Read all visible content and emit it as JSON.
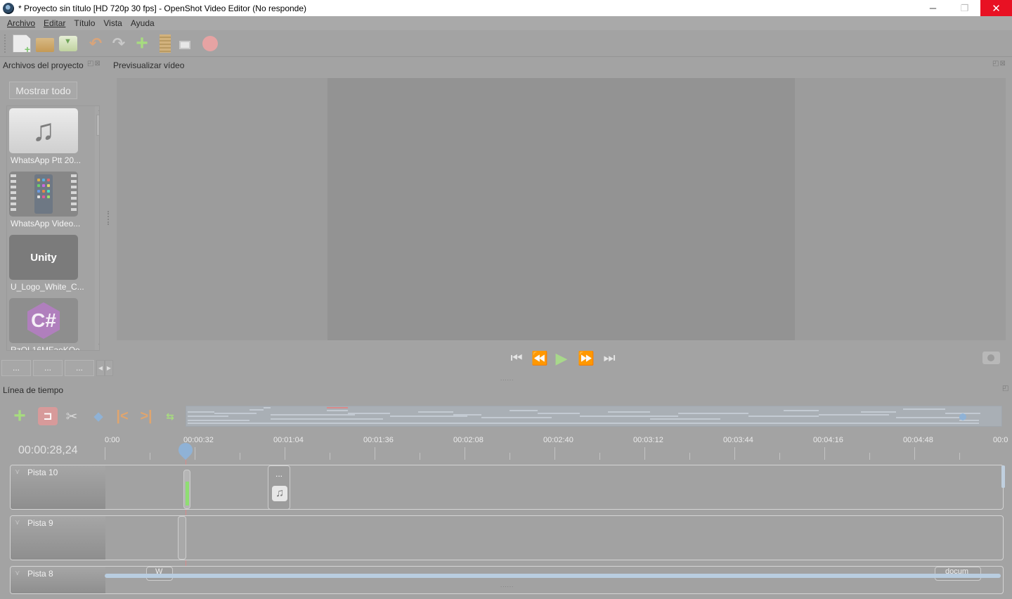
{
  "window": {
    "title": "* Proyecto sin título [HD 720p 30 fps] - OpenShot Video Editor (No responde)",
    "minimize": "─",
    "restore": "❐",
    "close": "✕"
  },
  "menu": [
    "Archivo",
    "Editar",
    "Título",
    "Vista",
    "Ayuda"
  ],
  "toolbar": {
    "icons": [
      "new-project-icon",
      "open-project-icon",
      "save-project-icon",
      "undo-icon",
      "redo-icon",
      "import-files-icon",
      "choose-profile-icon",
      "fullscreen-icon",
      "export-video-icon"
    ]
  },
  "project_files": {
    "header": "Archivos del proyecto",
    "dock_controls": "◰⊠",
    "show_all": "Mostrar todo",
    "files": [
      {
        "name": "WhatsApp Ptt 20...",
        "kind": "audio"
      },
      {
        "name": "WhatsApp Video...",
        "kind": "video"
      },
      {
        "name": "U_Logo_White_C...",
        "kind": "image",
        "thumb_text": "Unity"
      },
      {
        "name": "RzQL16MFaeKQe...",
        "kind": "image",
        "thumb_text": "C#"
      }
    ],
    "bottom_buttons": [
      "...",
      "...",
      "..."
    ],
    "scroll_left": "◀",
    "scroll_right": "▶"
  },
  "preview": {
    "header": "Previsualizar vídeo",
    "dock_controls": "◰⊠",
    "controls": {
      "jump_start": "⏮",
      "rewind": "⏪",
      "play": "▶",
      "fast_forward": "⏩",
      "jump_end": "⏭"
    },
    "splitter": "......"
  },
  "timeline": {
    "header": "Línea de tiempo",
    "dock_controls": "◰",
    "current_time": "00:00:28,24",
    "ruler_labels": [
      "0:00",
      "00:00:32",
      "00:01:04",
      "00:01:36",
      "00:02:08",
      "00:02:40",
      "00:03:12",
      "00:03:44",
      "00:04:16",
      "00:04:48",
      "00:0"
    ],
    "toolbar_icons": [
      "add-track-icon",
      "snapping-icon",
      "razor-icon",
      "add-marker-icon",
      "previous-marker-icon",
      "next-marker-icon",
      "center-timeline-icon"
    ],
    "tracks": [
      {
        "name": "Pista 10",
        "chevron": "⋎",
        "clip_menu": "...",
        "clip_icon": "♫"
      },
      {
        "name": "Pista 9",
        "chevron": "⋎"
      },
      {
        "name": "Pista 8",
        "chevron": "⋎",
        "clip_labels": [
          "W",
          "docum"
        ]
      }
    ],
    "splitter": "......"
  },
  "colors": {
    "background": "#a3a3a3",
    "accent_green": "#7cc46d",
    "close_red": "#e81123",
    "playhead_blue": "#8fb2d6"
  }
}
